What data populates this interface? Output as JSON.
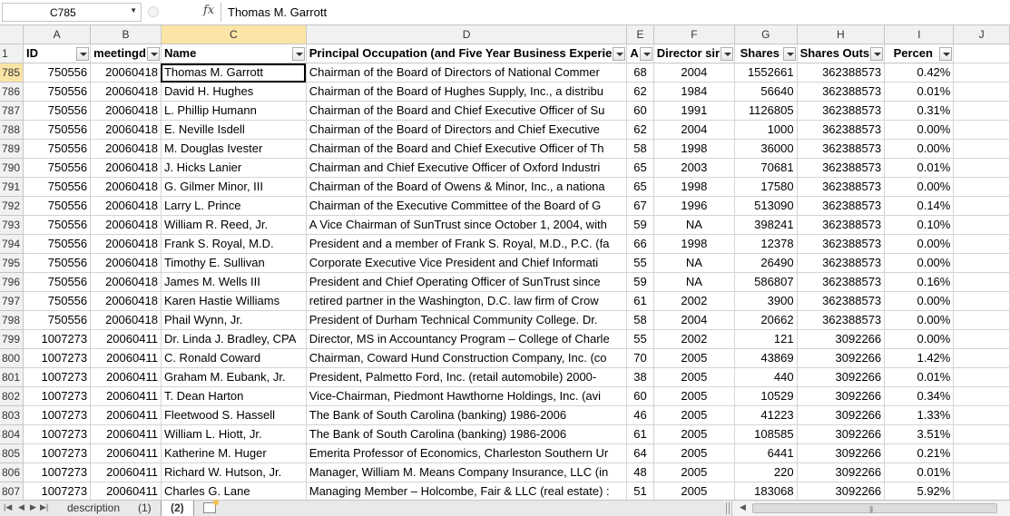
{
  "formula_bar": {
    "cell_ref": "C785",
    "fx": "fx",
    "value": "Thomas M. Garrott"
  },
  "columns": [
    "A",
    "B",
    "C",
    "D",
    "E",
    "F",
    "G",
    "H",
    "I",
    "J"
  ],
  "header_row": {
    "row_number": "1",
    "cells": [
      "ID",
      "meetingd",
      "Name",
      "Principal Occupation (and Five Year Business Experie",
      "A",
      "Director sir",
      "Shares",
      "Shares Outs",
      "Percen"
    ]
  },
  "rows": [
    {
      "n": "785",
      "id": "750556",
      "date": "20060418",
      "name": "Thomas M. Garrott",
      "occ": "Chairman of the Board of Directors of National Commer",
      "age": "68",
      "since": "2004",
      "shares": "1552661",
      "out": "362388573",
      "pct": "0.42%"
    },
    {
      "n": "786",
      "id": "750556",
      "date": "20060418",
      "name": "David H. Hughes",
      "occ": "Chairman of the Board of Hughes Supply, Inc., a distribu",
      "age": "62",
      "since": "1984",
      "shares": "56640",
      "out": "362388573",
      "pct": "0.01%"
    },
    {
      "n": "787",
      "id": "750556",
      "date": "20060418",
      "name": "L. Phillip Humann",
      "occ": "Chairman of the Board and Chief Executive Officer of Su",
      "age": "60",
      "since": "1991",
      "shares": "1126805",
      "out": "362388573",
      "pct": "0.31%"
    },
    {
      "n": "788",
      "id": "750556",
      "date": "20060418",
      "name": "E. Neville Isdell",
      "occ": "Chairman of the Board of Directors and Chief Executive",
      "age": "62",
      "since": "2004",
      "shares": "1000",
      "out": "362388573",
      "pct": "0.00%"
    },
    {
      "n": "789",
      "id": "750556",
      "date": "20060418",
      "name": "M. Douglas Ivester",
      "occ": "Chairman of the Board and Chief Executive Officer of Th",
      "age": "58",
      "since": "1998",
      "shares": "36000",
      "out": "362388573",
      "pct": "0.00%"
    },
    {
      "n": "790",
      "id": "750556",
      "date": "20060418",
      "name": "J. Hicks Lanier",
      "occ": "Chairman and Chief Executive Officer of Oxford Industri",
      "age": "65",
      "since": "2003",
      "shares": "70681",
      "out": "362388573",
      "pct": "0.01%"
    },
    {
      "n": "791",
      "id": "750556",
      "date": "20060418",
      "name": "G. Gilmer Minor, III",
      "occ": "Chairman of the Board of Owens & Minor, Inc., a nationa",
      "age": "65",
      "since": "1998",
      "shares": "17580",
      "out": "362388573",
      "pct": "0.00%"
    },
    {
      "n": "792",
      "id": "750556",
      "date": "20060418",
      "name": "Larry L. Prince",
      "occ": "Chairman of the Executive Committee of the Board of G",
      "age": "67",
      "since": "1996",
      "shares": "513090",
      "out": "362388573",
      "pct": "0.14%"
    },
    {
      "n": "793",
      "id": "750556",
      "date": "20060418",
      "name": "William R. Reed, Jr.",
      "occ": "A Vice Chairman of SunTrust since October 1, 2004, with",
      "age": "59",
      "since": "NA",
      "shares": "398241",
      "out": "362388573",
      "pct": "0.10%"
    },
    {
      "n": "794",
      "id": "750556",
      "date": "20060418",
      "name": "Frank S. Royal, M.D.",
      "occ": "President and a member of Frank S. Royal, M.D., P.C. (fa",
      "age": "66",
      "since": "1998",
      "shares": "12378",
      "out": "362388573",
      "pct": "0.00%"
    },
    {
      "n": "795",
      "id": "750556",
      "date": "20060418",
      "name": "Timothy E. Sullivan",
      "occ": "Corporate Executive Vice President and Chief Informati",
      "age": "55",
      "since": "NA",
      "shares": "26490",
      "out": "362388573",
      "pct": "0.00%"
    },
    {
      "n": "796",
      "id": "750556",
      "date": "20060418",
      "name": "James M. Wells III",
      "occ": "President and Chief Operating Officer of SunTrust since",
      "age": "59",
      "since": "NA",
      "shares": "586807",
      "out": "362388573",
      "pct": "0.16%"
    },
    {
      "n": "797",
      "id": "750556",
      "date": "20060418",
      "name": "Karen Hastie Williams",
      "occ": "retired partner in the Washington, D.C. law firm of Crow",
      "age": "61",
      "since": "2002",
      "shares": "3900",
      "out": "362388573",
      "pct": "0.00%"
    },
    {
      "n": "798",
      "id": "750556",
      "date": "20060418",
      "name": "Phail Wynn, Jr.",
      "occ": "President of Durham Technical Community College. Dr.",
      "age": "58",
      "since": "2004",
      "shares": "20662",
      "out": "362388573",
      "pct": "0.00%"
    },
    {
      "n": "799",
      "id": "1007273",
      "date": "20060411",
      "name": "Dr. Linda J. Bradley, CPA",
      "occ": "Director, MS in Accountancy Program – College of Charle",
      "age": "55",
      "since": "2002",
      "shares": "121",
      "out": "3092266",
      "pct": "0.00%"
    },
    {
      "n": "800",
      "id": "1007273",
      "date": "20060411",
      "name": "C. Ronald Coward",
      "occ": "Chairman, Coward Hund Construction Company, Inc. (co",
      "age": "70",
      "since": "2005",
      "shares": "43869",
      "out": "3092266",
      "pct": "1.42%"
    },
    {
      "n": "801",
      "id": "1007273",
      "date": "20060411",
      "name": "Graham M. Eubank, Jr.",
      "occ": "President, Palmetto Ford, Inc. (retail automobile) 2000-",
      "age": "38",
      "since": "2005",
      "shares": "440",
      "out": "3092266",
      "pct": "0.01%"
    },
    {
      "n": "802",
      "id": "1007273",
      "date": "20060411",
      "name": "T. Dean Harton",
      "occ": "Vice-Chairman, Piedmont Hawthorne Holdings, Inc. (avi",
      "age": "60",
      "since": "2005",
      "shares": "10529",
      "out": "3092266",
      "pct": "0.34%"
    },
    {
      "n": "803",
      "id": "1007273",
      "date": "20060411",
      "name": "Fleetwood S. Hassell",
      "occ": "The Bank of South Carolina (banking) 1986-2006",
      "age": "46",
      "since": "2005",
      "shares": "41223",
      "out": "3092266",
      "pct": "1.33%"
    },
    {
      "n": "804",
      "id": "1007273",
      "date": "20060411",
      "name": "William L. Hiott, Jr.",
      "occ": "The Bank of South Carolina (banking) 1986-2006",
      "age": "61",
      "since": "2005",
      "shares": "108585",
      "out": "3092266",
      "pct": "3.51%"
    },
    {
      "n": "805",
      "id": "1007273",
      "date": "20060411",
      "name": "Katherine M. Huger",
      "occ": "Emerita Professor of Economics, Charleston Southern Ur",
      "age": "64",
      "since": "2005",
      "shares": "6441",
      "out": "3092266",
      "pct": "0.21%"
    },
    {
      "n": "806",
      "id": "1007273",
      "date": "20060411",
      "name": "Richard W. Hutson, Jr.",
      "occ": "Manager, William M. Means Company Insurance, LLC (in",
      "age": "48",
      "since": "2005",
      "shares": "220",
      "out": "3092266",
      "pct": "0.01%"
    },
    {
      "n": "807",
      "id": "1007273",
      "date": "20060411",
      "name": "Charles G. Lane",
      "occ": "Managing Member – Holcombe, Fair & LLC (real estate) :",
      "age": "51",
      "since": "2005",
      "shares": "183068",
      "out": "3092266",
      "pct": "5.92%"
    }
  ],
  "sheet_tabs": [
    "description",
    "(1)",
    "(2)"
  ],
  "active_tab": "(2)"
}
